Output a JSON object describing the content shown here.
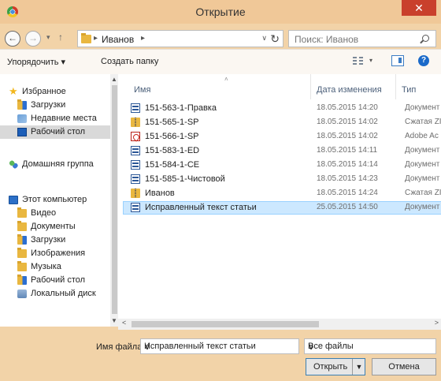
{
  "window": {
    "title": "Открытие",
    "close_glyph": "✕"
  },
  "nav": {
    "back_glyph": "←",
    "forward_glyph": "→",
    "history_glyph": "▾",
    "up_glyph": "↑",
    "address": {
      "separator": "▸",
      "path": "Иванов",
      "trail_separator": "▸",
      "dropdown_glyph": "∨",
      "refresh_glyph": "↻"
    },
    "search": {
      "placeholder": "Поиск: Иванов"
    }
  },
  "toolbar": {
    "organize_label": "Упорядочить ▾",
    "new_folder_label": "Создать папку",
    "views_dropdown_glyph": "▾",
    "help_glyph": "?"
  },
  "sidebar": {
    "items": [
      {
        "label": "Избранное",
        "icon": "star-icon"
      },
      {
        "label": "Загрузки",
        "icon": "downloads-folder-icon"
      },
      {
        "label": "Недавние места",
        "icon": "recent-places-icon"
      },
      {
        "label": "Рабочий стол",
        "icon": "desktop-icon",
        "selected": true
      },
      {
        "label": "Домашняя группа",
        "icon": "homegroup-icon"
      },
      {
        "label": "Этот компьютер",
        "icon": "computer-icon"
      },
      {
        "label": "Видео",
        "icon": "videos-folder-icon"
      },
      {
        "label": "Документы",
        "icon": "documents-folder-icon"
      },
      {
        "label": "Загрузки",
        "icon": "downloads-folder-icon"
      },
      {
        "label": "Изображения",
        "icon": "pictures-folder-icon"
      },
      {
        "label": "Музыка",
        "icon": "music-folder-icon"
      },
      {
        "label": "Рабочий стол",
        "icon": "desktop-folder-icon"
      },
      {
        "label": "Локальный диск",
        "icon": "local-disk-icon"
      }
    ],
    "scroll_up_glyph": "▲",
    "scroll_down_glyph": "▼"
  },
  "files": {
    "columns": {
      "name": "Имя",
      "date": "Дата изменения",
      "type": "Тип"
    },
    "sort_glyph": "˄",
    "rows": [
      {
        "name": "151-563-1-Правка",
        "date": "18.05.2015 14:20",
        "type": "Документ",
        "icon": "word-document-icon"
      },
      {
        "name": "151-565-1-SP",
        "date": "18.05.2015 14:02",
        "type": "Сжатая ZI",
        "icon": "zip-folder-icon"
      },
      {
        "name": "151-566-1-SP",
        "date": "18.05.2015 14:02",
        "type": "Adobe Ac",
        "icon": "pdf-file-icon"
      },
      {
        "name": "151-583-1-ED",
        "date": "18.05.2015 14:11",
        "type": "Документ",
        "icon": "word-document-icon"
      },
      {
        "name": "151-584-1-CE",
        "date": "18.05.2015 14:14",
        "type": "Документ",
        "icon": "word-document-icon"
      },
      {
        "name": "151-585-1-Чистовой",
        "date": "18.05.2015 14:23",
        "type": "Документ",
        "icon": "word-document-icon"
      },
      {
        "name": "Иванов",
        "date": "18.05.2015 14:24",
        "type": "Сжатая ZI",
        "icon": "zip-folder-icon"
      },
      {
        "name": "Исправленный текст статьи",
        "date": "25.05.2015 14:50",
        "type": "Документ",
        "icon": "word-document-icon",
        "selected": true
      }
    ],
    "hscroll_left_glyph": "<",
    "hscroll_right_glyph": ">"
  },
  "footer": {
    "filename_label": "Имя файла:",
    "filename_value": "Исправленный текст статьи",
    "filename_dropdown_glyph": "∨",
    "filetype_value": "Все файлы",
    "filetype_dropdown_glyph": "∨",
    "open_label": "Открыть",
    "open_dropdown_glyph": "▼",
    "cancel_label": "Отмена"
  },
  "colors": {
    "titlebar": "#f0c898",
    "close_button": "#c9402c",
    "selection": "#cce8ff",
    "nav_selected": "#d9d9d9"
  }
}
